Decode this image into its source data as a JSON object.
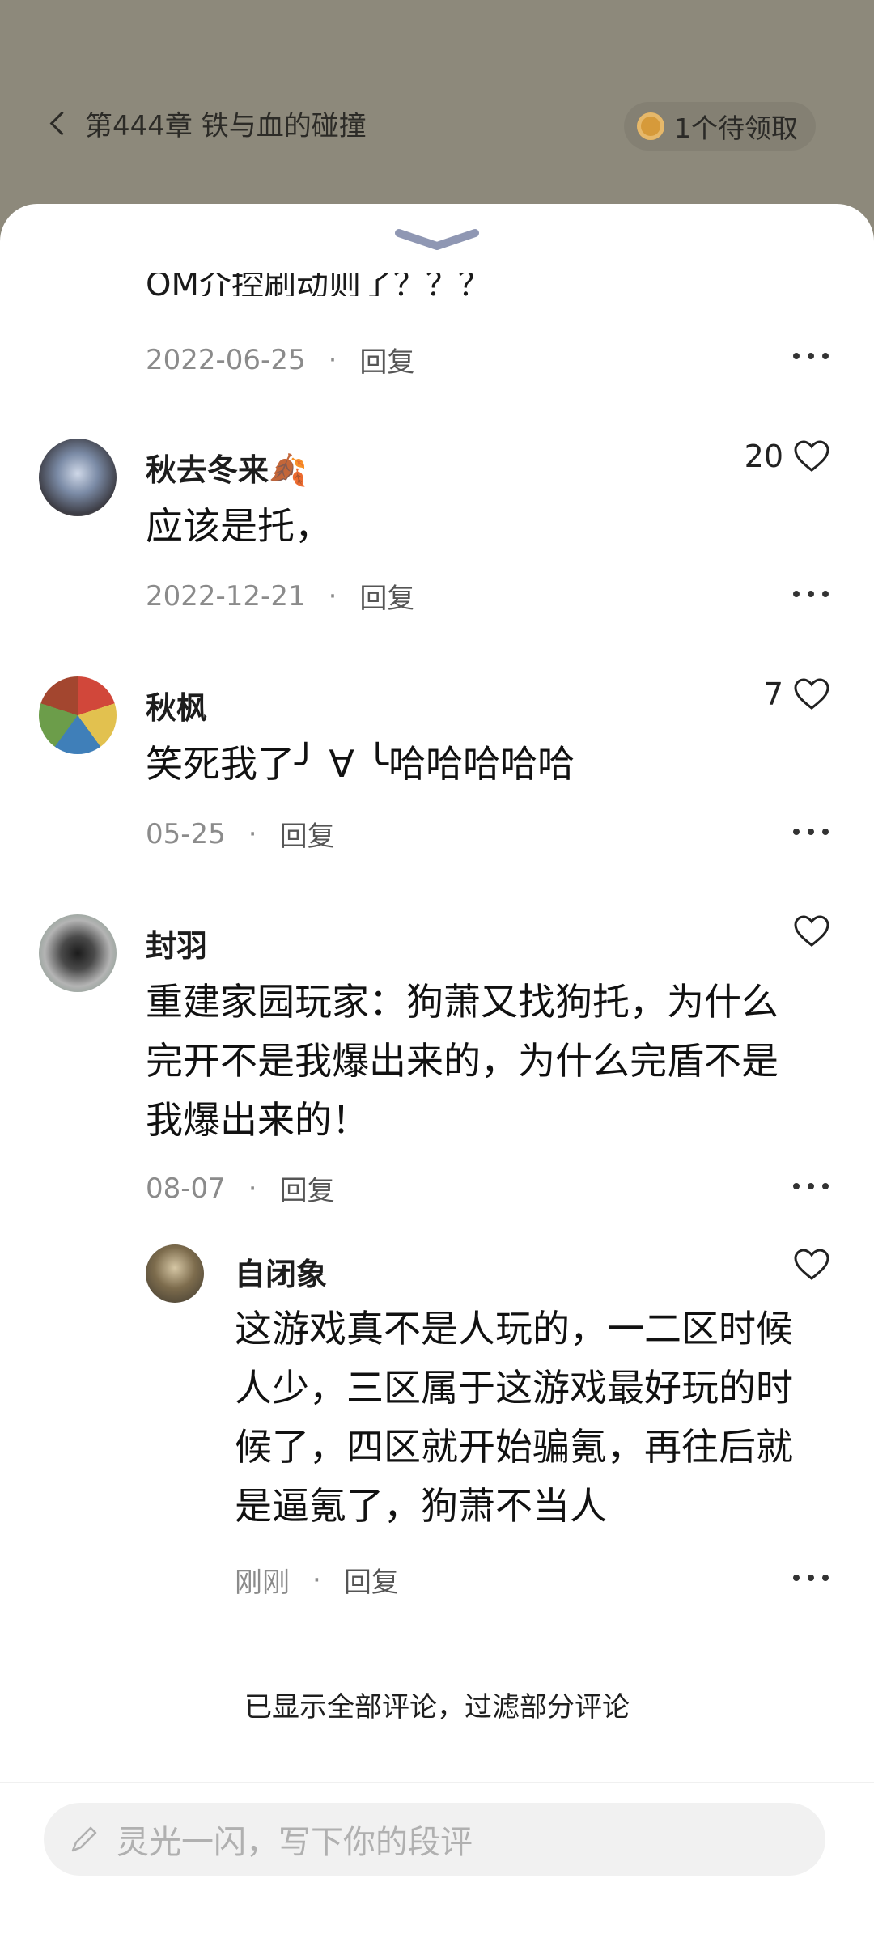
{
  "header": {
    "chapter_title": "第444章 铁与血的碰撞",
    "claim_label": "1个待领取"
  },
  "sheet": {
    "partial_text": "OM介控刷动则了？？？",
    "first_meta": {
      "date": "2022-06-25",
      "reply": "回复"
    },
    "comments": [
      {
        "user": "秋去冬来🍂",
        "text": "应该是托，",
        "date": "2022-12-21",
        "reply": "回复",
        "likes": "20"
      },
      {
        "user": "秋枫",
        "text": "笑死我了╯ ∀ ╰哈哈哈哈哈",
        "date": "05-25",
        "reply": "回复",
        "likes": "7"
      },
      {
        "user": "封羽",
        "text": "重建家园玩家：狗萧又找狗托，为什么完开不是我爆出来的，为什么完盾不是我爆出来的！",
        "date": "08-07",
        "reply": "回复",
        "likes": ""
      }
    ],
    "reply_thread": {
      "user": "自闭象",
      "text": "这游戏真不是人玩的，一二区时候人少，三区属于这游戏最好玩的时候了，四区就开始骗氪，再往后就是逼氪了，狗萧不当人",
      "date": "刚刚",
      "reply": "回复"
    },
    "end_note": "已显示全部评论，过滤部分评论",
    "input_placeholder": "灵光一闪，写下你的段评"
  },
  "colors": {
    "overlay": "#8d897b",
    "sheet": "#ffffff",
    "collapse_handle": "#8f97b3"
  },
  "icons": [
    "chevron-left-icon",
    "coin-icon",
    "collapse-chevron-icon",
    "heart-icon",
    "more-icon",
    "pencil-icon"
  ]
}
